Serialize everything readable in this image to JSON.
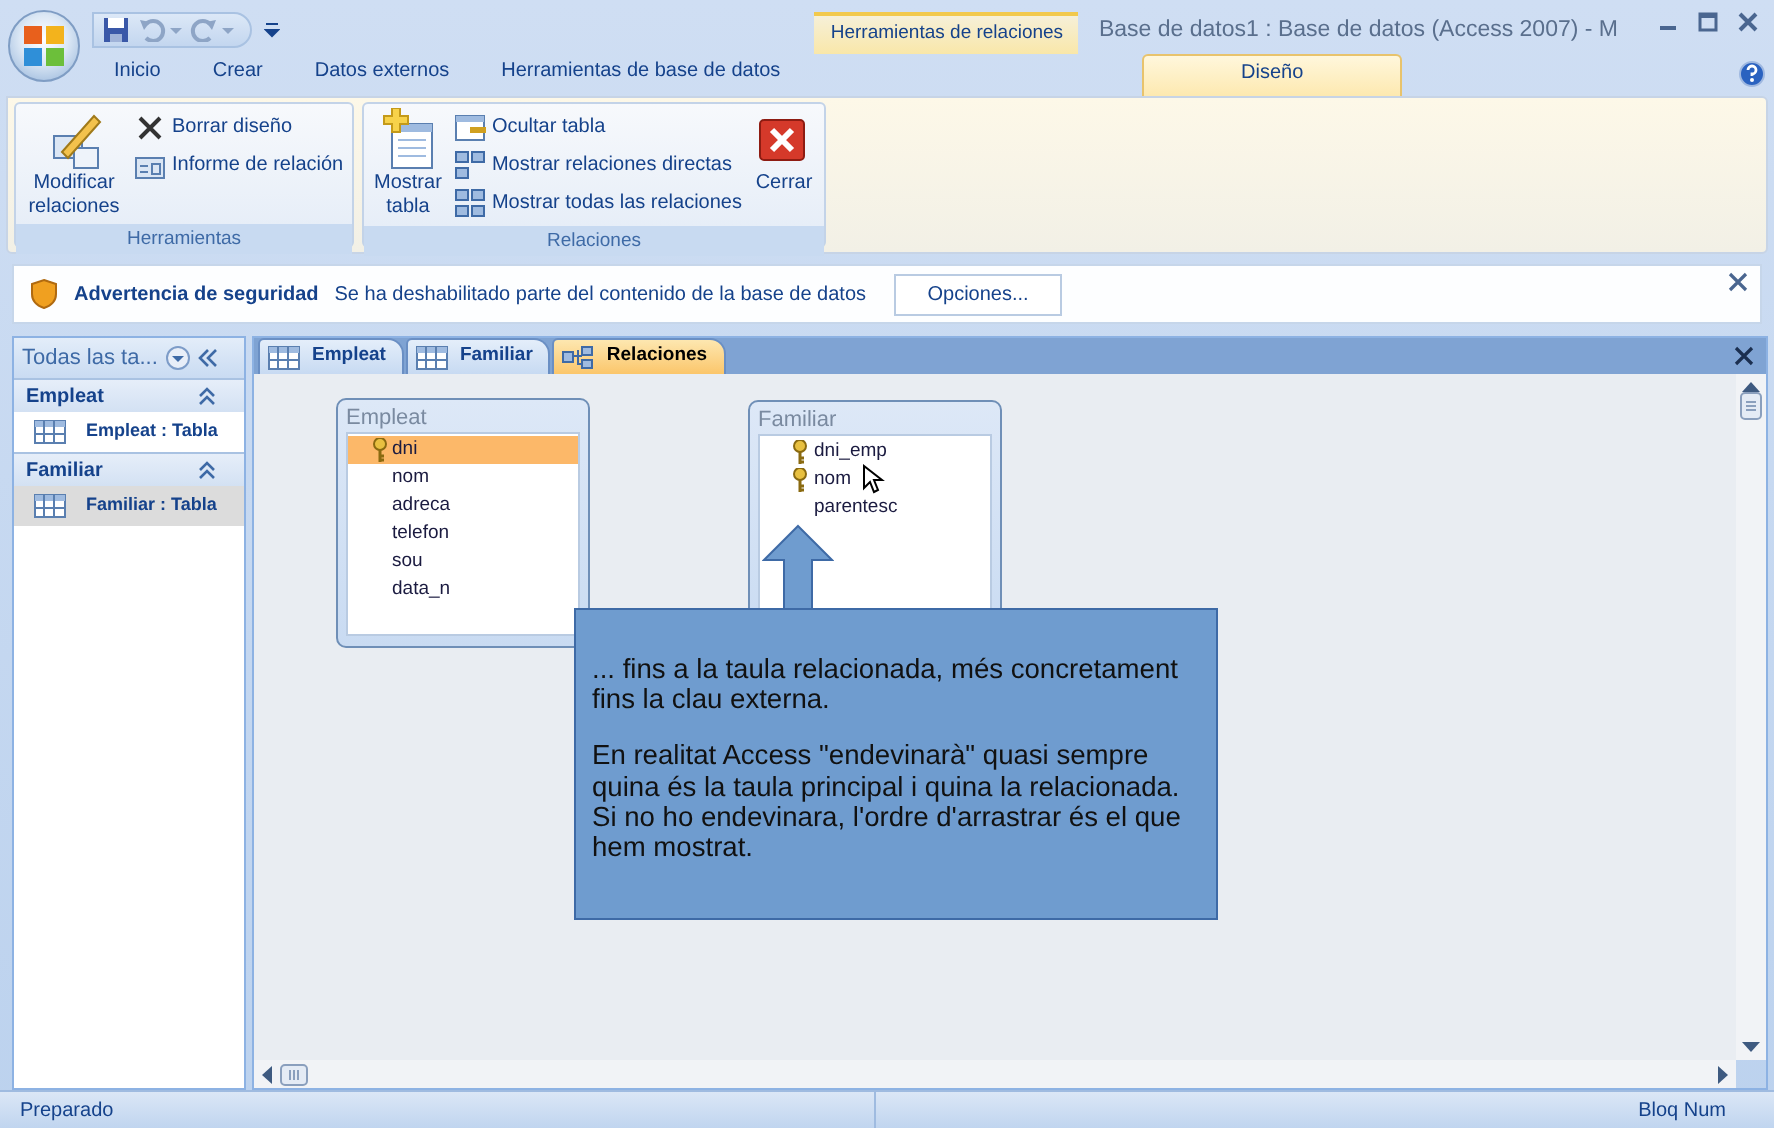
{
  "window": {
    "title": "Base de datos1 : Base de datos (Access 2007) - M",
    "contextual_group": "Herramientas de relaciones"
  },
  "ribbon_tabs": [
    {
      "label": "Inicio",
      "selected": false
    },
    {
      "label": "Crear",
      "selected": false
    },
    {
      "label": "Datos externos",
      "selected": false
    },
    {
      "label": "Herramientas de base de datos",
      "selected": false
    },
    {
      "label": "Diseño",
      "selected": true
    }
  ],
  "ribbon_groups": [
    {
      "label": "Herramientas",
      "commands": [
        {
          "label": "Modificar relaciones",
          "kind": "large"
        },
        {
          "label": "Borrar diseño",
          "kind": "small"
        },
        {
          "label": "Informe de relación",
          "kind": "small"
        }
      ]
    },
    {
      "label": "Relaciones",
      "commands": [
        {
          "label": "Mostrar tabla",
          "kind": "large"
        },
        {
          "label": "Ocultar tabla",
          "kind": "small"
        },
        {
          "label": "Mostrar relaciones directas",
          "kind": "small"
        },
        {
          "label": "Mostrar todas las relaciones",
          "kind": "small"
        },
        {
          "label": "Cerrar",
          "kind": "large"
        }
      ]
    }
  ],
  "security_bar": {
    "title": "Advertencia de seguridad",
    "message": "Se ha deshabilitado parte del contenido de la base de datos",
    "button": "Opciones..."
  },
  "nav_pane": {
    "header": "Todas las ta...",
    "groups": [
      {
        "label": "Empleat",
        "expanded": true,
        "items": [
          {
            "label": "Empleat : Tabla",
            "selected": false
          }
        ]
      },
      {
        "label": "Familiar",
        "expanded": true,
        "items": [
          {
            "label": "Familiar : Tabla",
            "selected": true
          }
        ]
      }
    ]
  },
  "doc_tabs": [
    {
      "label": "Empleat",
      "kind": "table",
      "selected": false
    },
    {
      "label": "Familiar",
      "kind": "table",
      "selected": false
    },
    {
      "label": "Relaciones",
      "kind": "relationships",
      "selected": true
    }
  ],
  "relationship_tables": [
    {
      "title": "Empleat",
      "fields": [
        {
          "name": "dni",
          "key": true,
          "selected": true
        },
        {
          "name": "nom",
          "key": false,
          "selected": false
        },
        {
          "name": "adreca",
          "key": false,
          "selected": false
        },
        {
          "name": "telefon",
          "key": false,
          "selected": false
        },
        {
          "name": "sou",
          "key": false,
          "selected": false
        },
        {
          "name": "data_n",
          "key": false,
          "selected": false
        }
      ]
    },
    {
      "title": "Familiar",
      "fields": [
        {
          "name": "dni_emp",
          "key": true,
          "selected": false
        },
        {
          "name": "nom",
          "key": true,
          "selected": false
        },
        {
          "name": "parentesc",
          "key": false,
          "selected": false
        }
      ]
    }
  ],
  "callout": {
    "paragraphs": [
      "... fins a la taula relacionada, més concretament fins la clau externa.",
      "En realitat Access \"endevinarà\" quasi sempre quina és la taula principal i quina la relacionada. Si no ho endevinara, l'ordre d'arrastrar és el que hem mostrat."
    ]
  },
  "status_bar": {
    "left": "Preparado",
    "right": "Bloq Num"
  }
}
